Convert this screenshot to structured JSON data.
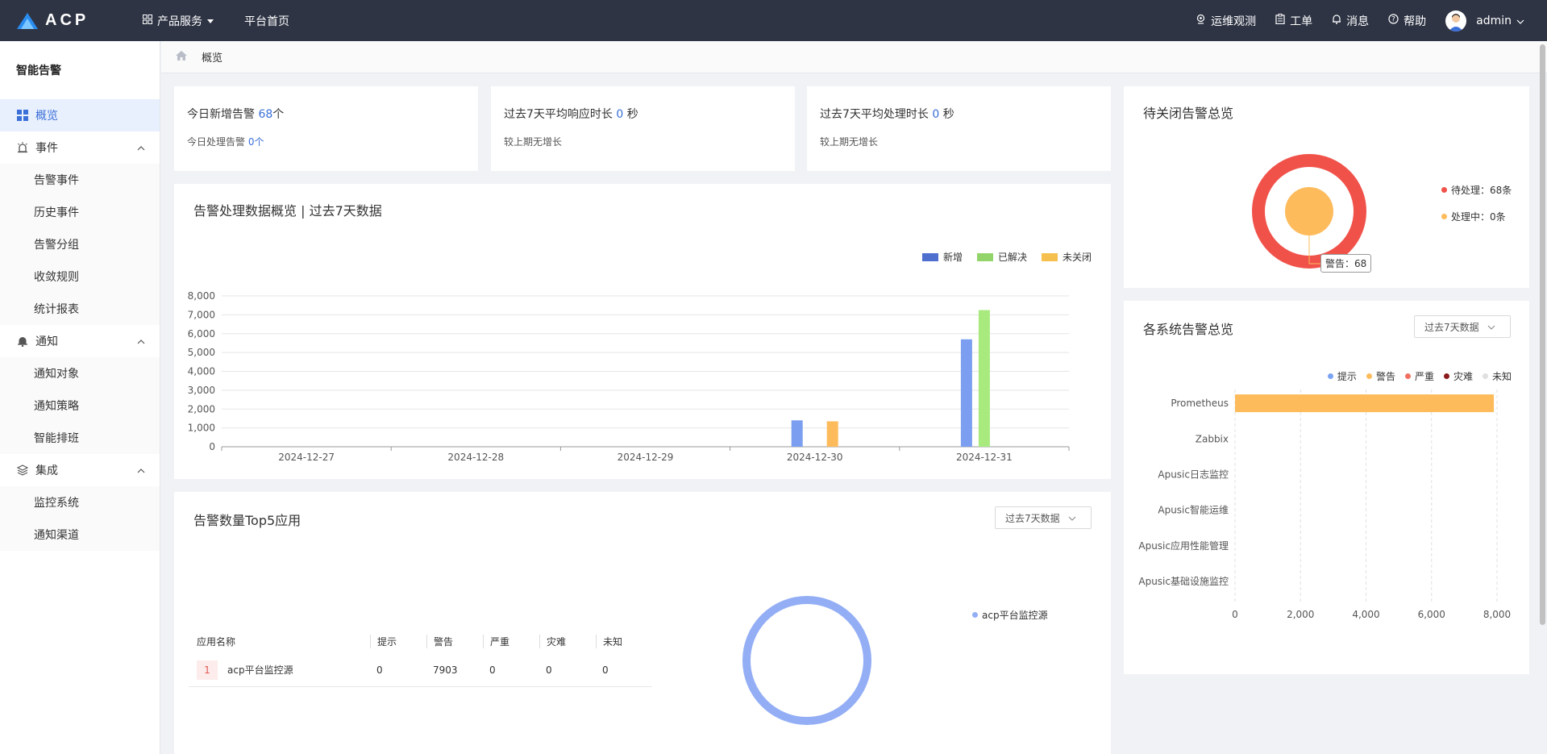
{
  "topbar": {
    "logo_text": "ACP",
    "nav": [
      {
        "label": "产品服务"
      },
      {
        "label": "平台首页"
      }
    ],
    "right": [
      {
        "label": "运维观测"
      },
      {
        "label": "工单"
      },
      {
        "label": "消息"
      },
      {
        "label": "帮助"
      }
    ],
    "user": "admin"
  },
  "sidebar": {
    "title": "智能告警",
    "overview": "概览",
    "groups": [
      {
        "label": "事件",
        "items": [
          "告警事件",
          "历史事件",
          "告警分组",
          "收敛规则",
          "统计报表"
        ]
      },
      {
        "label": "通知",
        "items": [
          "通知对象",
          "通知策略",
          "智能排班"
        ]
      },
      {
        "label": "集成",
        "items": [
          "监控系统",
          "通知渠道"
        ]
      }
    ]
  },
  "breadcrumb": {
    "current": "概览"
  },
  "stats": [
    {
      "main_prefix": "今日新增告警",
      "main_value": "68",
      "main_suffix": "个",
      "sub_prefix": "今日处理告警",
      "sub_value": "0",
      "sub_suffix": "个"
    },
    {
      "main_prefix": "过去7天平均响应时长",
      "main_value": "0",
      "main_suffix": "秒",
      "sub_text": "较上期无增长"
    },
    {
      "main_prefix": "过去7天平均处理时长",
      "main_value": "0",
      "main_suffix": "秒",
      "sub_text": "较上期无增长"
    }
  ],
  "trend_card": {
    "title": "告警处理数据概览 | 过去7天数据"
  },
  "pending_card": {
    "title": "待关闭告警总览",
    "legend": [
      {
        "label": "待处理：68条",
        "color": "#f0524a"
      },
      {
        "label": "处理中：0条",
        "color": "#fdbb5c"
      }
    ],
    "tooltip": "警告：68"
  },
  "system_card": {
    "title": "各系统告警总览",
    "select": "过去7天数据",
    "legend": [
      {
        "label": "提示",
        "color": "#7ba4f5"
      },
      {
        "label": "警告",
        "color": "#fdbb5c"
      },
      {
        "label": "严重",
        "color": "#f27062"
      },
      {
        "label": "灾难",
        "color": "#8b1a1a"
      },
      {
        "label": "未知",
        "color": "#e0e0e0"
      }
    ]
  },
  "top5_card": {
    "title": "告警数量Top5应用",
    "select": "过去7天数据",
    "columns": [
      "应用名称",
      "提示",
      "警告",
      "严重",
      "灾难",
      "未知"
    ],
    "rows": [
      {
        "rank": "1",
        "name": "acp平台监控源",
        "values": [
          "0",
          "7903",
          "0",
          "0",
          "0"
        ]
      }
    ],
    "donut_legend": {
      "label": "acp平台监控源",
      "color": "#93aef5"
    }
  },
  "chart_data": [
    {
      "type": "bar",
      "categories": [
        "2024-12-27",
        "2024-12-28",
        "2024-12-29",
        "2024-12-30",
        "2024-12-31"
      ],
      "series": [
        {
          "name": "新增",
          "color": "#7b9ef0",
          "legend_color": "#4e6fce",
          "values": [
            0,
            0,
            0,
            1400,
            5700
          ]
        },
        {
          "name": "已解决",
          "color": "#a8ea7e",
          "legend_color": "#93d46a",
          "values": [
            0,
            0,
            0,
            0,
            7250
          ]
        },
        {
          "name": "未关闭",
          "color": "#fdbb5c",
          "legend_color": "#f6c04f",
          "values": [
            0,
            0,
            0,
            1350,
            0
          ]
        }
      ],
      "ylim": [
        0,
        8000
      ],
      "yticks": [
        0,
        1000,
        2000,
        3000,
        4000,
        5000,
        6000,
        7000,
        8000
      ],
      "ytick_labels": [
        "0",
        "1,000",
        "2,000",
        "3,000",
        "4,000",
        "5,000",
        "6,000",
        "7,000",
        "8,000"
      ],
      "legend_position": "top-right",
      "grid": true
    },
    {
      "type": "pie",
      "style": "donut",
      "slices": [
        {
          "name": "待处理",
          "value": 68,
          "color": "#f0524a"
        },
        {
          "name": "处理中",
          "value": 0,
          "color": "#fdbb5c"
        }
      ]
    },
    {
      "type": "bar",
      "orientation": "horizontal",
      "categories": [
        "Prometheus",
        "Zabbix",
        "Apusic日志监控",
        "Apusic智能运维",
        "Apusic应用性能管理",
        "Apusic基础设施监控"
      ],
      "series": [
        {
          "name": "警告",
          "color": "#fdbb5c",
          "values": [
            7903,
            0,
            0,
            0,
            0,
            0
          ]
        }
      ],
      "xlim": [
        0,
        8000
      ],
      "xticks": [
        0,
        2000,
        4000,
        6000,
        8000
      ],
      "xtick_labels": [
        "0",
        "2,000",
        "4,000",
        "6,000",
        "8,000"
      ],
      "grid": true
    },
    {
      "type": "pie",
      "style": "donut",
      "slices": [
        {
          "name": "acp平台监控源",
          "value": 7903,
          "color": "#93aef5"
        }
      ]
    }
  ]
}
